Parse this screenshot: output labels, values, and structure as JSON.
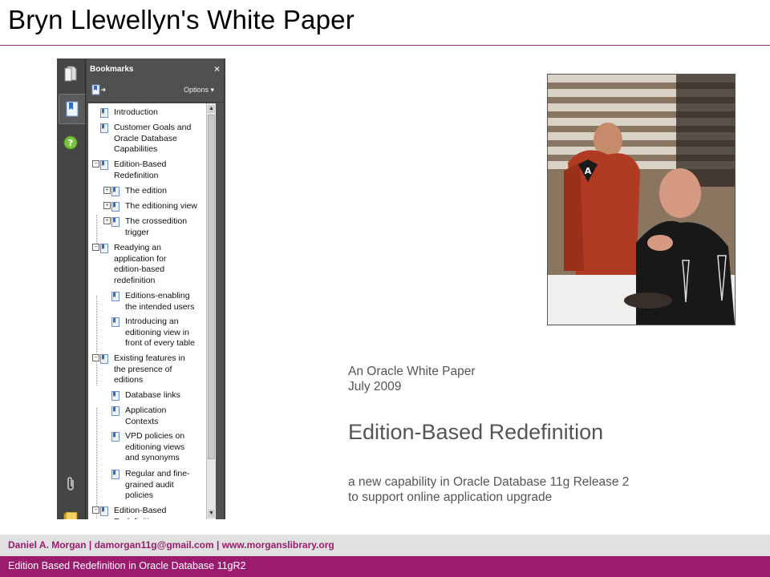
{
  "slide": {
    "title": "Bryn Llewellyn's White Paper"
  },
  "viewer": {
    "panel_title": "Bookmarks",
    "close_glyph": "×",
    "options_label": "Options ▾",
    "rail_icons": [
      "pages-icon",
      "bookmarks-icon",
      "help-icon",
      "attachment-icon",
      "layers-icon"
    ],
    "bookmarks": [
      {
        "label": "Introduction",
        "level": 0
      },
      {
        "label": "Customer Goals and Oracle Database Capabilities",
        "level": 0
      },
      {
        "label": "Edition-Based Redefinition",
        "level": 0,
        "expanded": true
      },
      {
        "label": "The edition",
        "level": 1,
        "collapsed": true
      },
      {
        "label": "The editioning view",
        "level": 1,
        "collapsed": true
      },
      {
        "label": "The crossedition trigger",
        "level": 1,
        "collapsed": true
      },
      {
        "label": "Readying an application for edition-based redefinition",
        "level": 0,
        "expanded": true
      },
      {
        "label": "Editions-enabling the intended users",
        "level": 1
      },
      {
        "label": "Introducing an editioning view in front of every table",
        "level": 1
      },
      {
        "label": "Existing features in the presence of editions",
        "level": 0,
        "expanded": true
      },
      {
        "label": "Database links",
        "level": 1
      },
      {
        "label": "Application Contexts",
        "level": 1
      },
      {
        "label": "VPD policies on editioning views and synonyms",
        "level": 1
      },
      {
        "label": "Regular and fine-grained audit policies",
        "level": 1
      },
      {
        "label": "Edition-Based Redefinition",
        "level": 0,
        "expanded": true
      }
    ]
  },
  "white_paper": {
    "kicker_line1": "An Oracle White Paper",
    "kicker_line2": "July 2009",
    "title": "Edition-Based Redefinition",
    "subtitle_line1": "a new capability in Oracle Database 11g Release 2",
    "subtitle_line2": "to support online application upgrade"
  },
  "footer": {
    "contact": "Daniel A. Morgan   |   damorgan11g@gmail.com   |   www.morganslibrary.org",
    "caption": "Edition Based Redefinition in Oracle Database 11gR2"
  },
  "colors": {
    "accent": "#9b1c6f",
    "footer_band": "#e1e1e1",
    "viewer_chrome": "#505050"
  }
}
